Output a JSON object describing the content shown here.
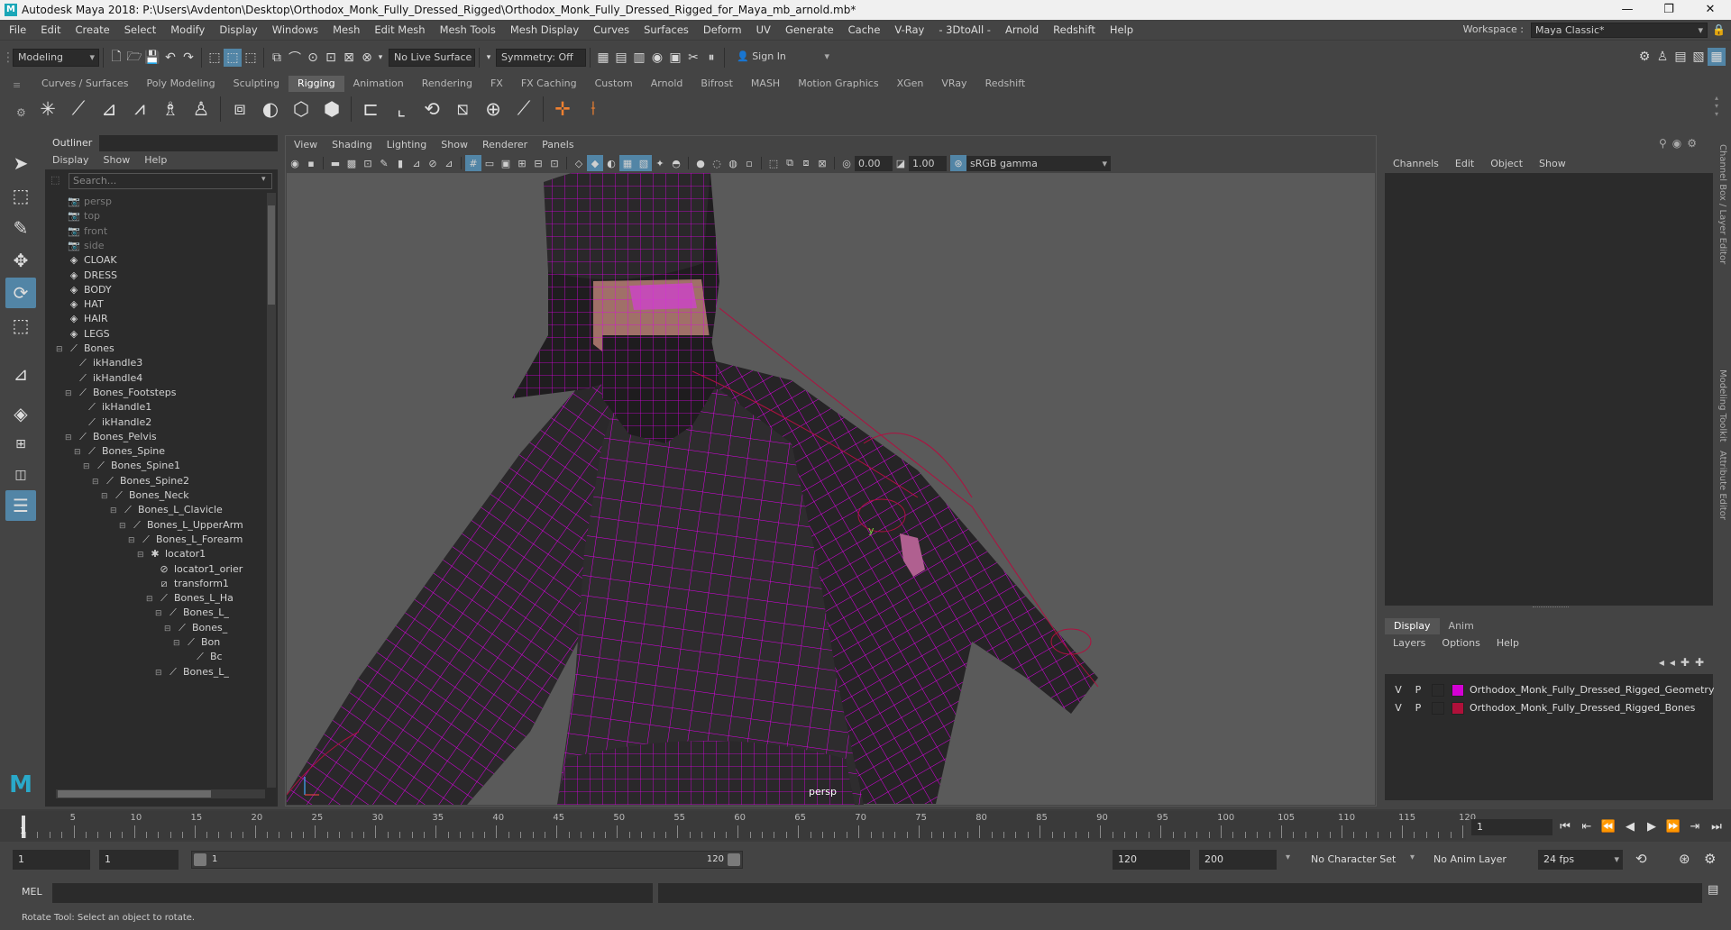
{
  "titlebar": {
    "title": "Autodesk Maya 2018: P:\\Users\\Avdenton\\Desktop\\Orthodox_Monk_Fully_Dressed_Rigged\\Orthodox_Monk_Fully_Dressed_Rigged_for_Maya_mb_arnold.mb*",
    "min": "—",
    "max": "❐",
    "close": "✕"
  },
  "menubar": {
    "items": [
      "File",
      "Edit",
      "Create",
      "Select",
      "Modify",
      "Display",
      "Windows",
      "Mesh",
      "Edit Mesh",
      "Mesh Tools",
      "Mesh Display",
      "Curves",
      "Surfaces",
      "Deform",
      "UV",
      "Generate",
      "Cache",
      "V-Ray",
      "- 3DtoAll -",
      "Arnold",
      "Redshift",
      "Help"
    ],
    "workspace_label": "Workspace :",
    "workspace_value": "Maya Classic*"
  },
  "statusline": {
    "mode": "Modeling",
    "live_surface": "No Live Surface",
    "symmetry": "Symmetry: Off",
    "sign_in": "Sign In"
  },
  "shelf": {
    "tabs": [
      "Curves / Surfaces",
      "Poly Modeling",
      "Sculpting",
      "Rigging",
      "Animation",
      "Rendering",
      "FX",
      "FX Caching",
      "Custom",
      "Arnold",
      "Bifrost",
      "MASH",
      "Motion Graphics",
      "XGen",
      "VRay",
      "Redshift"
    ],
    "active_tab": "Rigging"
  },
  "outliner": {
    "tab": "Outliner",
    "menu": [
      "Display",
      "Show",
      "Help"
    ],
    "search_placeholder": "Search...",
    "items": [
      {
        "label": "persp",
        "icon": "📷",
        "indent": 0,
        "dim": true
      },
      {
        "label": "top",
        "icon": "📷",
        "indent": 0,
        "dim": true
      },
      {
        "label": "front",
        "icon": "📷",
        "indent": 0,
        "dim": true
      },
      {
        "label": "side",
        "icon": "📷",
        "indent": 0,
        "dim": true
      },
      {
        "label": "CLOAK",
        "icon": "◈",
        "indent": 0
      },
      {
        "label": "DRESS",
        "icon": "◈",
        "indent": 0
      },
      {
        "label": "BODY",
        "icon": "◈",
        "indent": 0
      },
      {
        "label": "HAT",
        "icon": "◈",
        "indent": 0
      },
      {
        "label": "HAIR",
        "icon": "◈",
        "indent": 0
      },
      {
        "label": "LEGS",
        "icon": "◈",
        "indent": 0
      },
      {
        "label": "Bones",
        "icon": "⟋",
        "indent": 0,
        "ex": "⊟"
      },
      {
        "label": "ikHandle3",
        "icon": "⟋",
        "indent": 1
      },
      {
        "label": "ikHandle4",
        "icon": "⟋",
        "indent": 1
      },
      {
        "label": "Bones_Footsteps",
        "icon": "⟋",
        "indent": 1,
        "ex": "⊟"
      },
      {
        "label": "ikHandle1",
        "icon": "⟋",
        "indent": 2
      },
      {
        "label": "ikHandle2",
        "icon": "⟋",
        "indent": 2
      },
      {
        "label": "Bones_Pelvis",
        "icon": "⟋",
        "indent": 1,
        "ex": "⊟"
      },
      {
        "label": "Bones_Spine",
        "icon": "⟋",
        "indent": 2,
        "ex": "⊟"
      },
      {
        "label": "Bones_Spine1",
        "icon": "⟋",
        "indent": 3,
        "ex": "⊟"
      },
      {
        "label": "Bones_Spine2",
        "icon": "⟋",
        "indent": 4,
        "ex": "⊟"
      },
      {
        "label": "Bones_Neck",
        "icon": "⟋",
        "indent": 5,
        "ex": "⊟"
      },
      {
        "label": "Bones_L_Clavicle",
        "icon": "⟋",
        "indent": 6,
        "ex": "⊟"
      },
      {
        "label": "Bones_L_UpperArm",
        "icon": "⟋",
        "indent": 7,
        "ex": "⊟"
      },
      {
        "label": "Bones_L_Forearm",
        "icon": "⟋",
        "indent": 8,
        "ex": "⊟"
      },
      {
        "label": "locator1",
        "icon": "✱",
        "indent": 9,
        "ex": "⊟"
      },
      {
        "label": "locator1_orier",
        "icon": "⊘",
        "indent": 10
      },
      {
        "label": "transform1",
        "icon": "⧄",
        "indent": 10
      },
      {
        "label": "Bones_L_Ha",
        "icon": "⟋",
        "indent": 10,
        "ex": "⊟"
      },
      {
        "label": "Bones_L_",
        "icon": "⟋",
        "indent": 11,
        "ex": "⊟"
      },
      {
        "label": "Bones_",
        "icon": "⟋",
        "indent": 12,
        "ex": "⊟"
      },
      {
        "label": "Bon",
        "icon": "⟋",
        "indent": 13,
        "ex": "⊟"
      },
      {
        "label": "Bc",
        "icon": "⟋",
        "indent": 14
      },
      {
        "label": "Bones_L_",
        "icon": "⟋",
        "indent": 11,
        "ex": "⊟"
      }
    ]
  },
  "viewport": {
    "menu": [
      "View",
      "Shading",
      "Lighting",
      "Show",
      "Renderer",
      "Panels"
    ],
    "exposure": "0.00",
    "gamma": "1.00",
    "color_space": "sRGB gamma",
    "camera": "persp",
    "axis_y": "y",
    "wire_color": "#e000e8"
  },
  "channelbox": {
    "menu": [
      "Channels",
      "Edit",
      "Object",
      "Show"
    ],
    "vertical_tabs": [
      "Channel Box / Layer Editor",
      "Modeling Toolkit",
      "Attribute Editor"
    ]
  },
  "layers": {
    "tabs": [
      "Display",
      "Anim"
    ],
    "menu": [
      "Layers",
      "Options",
      "Help"
    ],
    "items": [
      {
        "v": "V",
        "p": "P",
        "color": "#d400d4",
        "name": "Orthodox_Monk_Fully_Dressed_Rigged_Geometry"
      },
      {
        "v": "V",
        "p": "P",
        "color": "#b0103a",
        "name": "Orthodox_Monk_Fully_Dressed_Rigged_Bones"
      }
    ]
  },
  "timeslider": {
    "ticks": [
      "5",
      "10",
      "15",
      "20",
      "25",
      "30",
      "35",
      "40",
      "45",
      "50",
      "55",
      "60",
      "65",
      "70",
      "75",
      "80",
      "85",
      "90",
      "95",
      "100",
      "105",
      "110",
      "115",
      "120"
    ],
    "start": 1,
    "end": 120,
    "playhead_label": "1",
    "current_frame": "1"
  },
  "rangeslider": {
    "start_field": "1",
    "inner_start": "1",
    "range_start_label": "1",
    "range_end_label": "120",
    "end_field": "120",
    "max_field": "200",
    "character_set": "No Character Set",
    "anim_layer": "No Anim Layer",
    "fps": "24 fps"
  },
  "cmdline": {
    "label": "MEL"
  },
  "helpline": {
    "text": "Rotate Tool: Select an object to rotate."
  }
}
